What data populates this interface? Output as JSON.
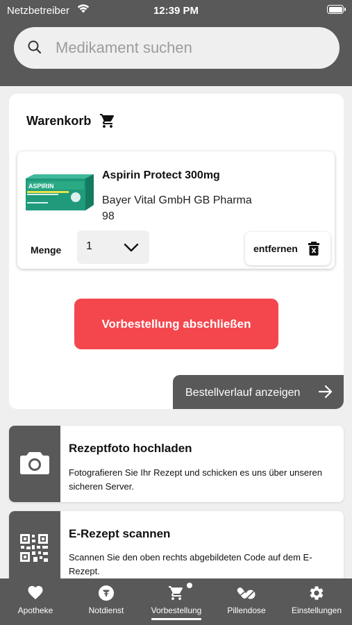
{
  "status_bar": {
    "carrier": "Netzbetreiber",
    "time": "12:39 PM"
  },
  "search": {
    "placeholder": "Medikament suchen"
  },
  "cart": {
    "title": "Warenkorb",
    "item": {
      "name": "Aspirin Protect 300mg",
      "manufacturer": "Bayer Vital GmbH GB Pharma",
      "pack_number": "98",
      "quantity_label": "Menge",
      "quantity_value": "1",
      "remove_label": "entfernen"
    },
    "order_button_label": "Vorbestellung abschließen",
    "history_button_label": "Bestellverlauf anzeigen"
  },
  "features": {
    "prescription_photo": {
      "title": "Rezeptfoto hochladen",
      "description": "Fotografieren Sie Ihr Rezept und schicken es uns über unseren sicheren Server."
    },
    "e_prescription": {
      "title": "E-Rezept scannen",
      "description": "Scannen Sie den oben rechts abgebildeten Code auf dem E-Rezept."
    }
  },
  "tabbar": {
    "tabs": [
      {
        "label": "Apotheke",
        "icon": "heart-icon"
      },
      {
        "label": "Notdienst",
        "icon": "emergency-pharmacy-icon"
      },
      {
        "label": "Vorbestellung",
        "icon": "cart-icon",
        "active": true,
        "badge_dot": true
      },
      {
        "label": "Pillendose",
        "icon": "pills-icon"
      },
      {
        "label": "Einstellungen",
        "icon": "gear-icon"
      }
    ]
  },
  "colors": {
    "header": "#595959",
    "accent_red": "#f4474d",
    "background": "#efefef",
    "card": "#ffffff"
  }
}
